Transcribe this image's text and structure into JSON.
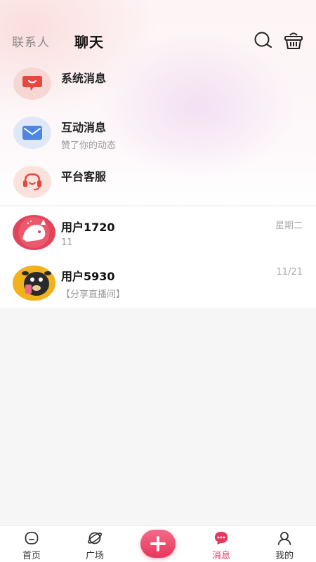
{
  "header": {
    "contacts_tab": "联系人",
    "chat_tab": "聊天"
  },
  "system_items": [
    {
      "title": "系统消息",
      "subtitle": "",
      "icon": "speech-bubble-icon"
    },
    {
      "title": "互动消息",
      "subtitle": "赞了你的动态",
      "icon": "envelope-icon"
    },
    {
      "title": "平台客服",
      "subtitle": "",
      "icon": "headset-icon"
    }
  ],
  "chats": [
    {
      "name": "用户1720",
      "message": "11",
      "time": "星期二"
    },
    {
      "name": "用户5930",
      "message": "【分享直播间】",
      "time": "11/21"
    }
  ],
  "tabbar": {
    "home": "首页",
    "plaza": "广场",
    "messages": "消息",
    "mine": "我的"
  },
  "colors": {
    "accent": "#e8365d",
    "text_primary": "#222222",
    "text_secondary": "#999999"
  }
}
